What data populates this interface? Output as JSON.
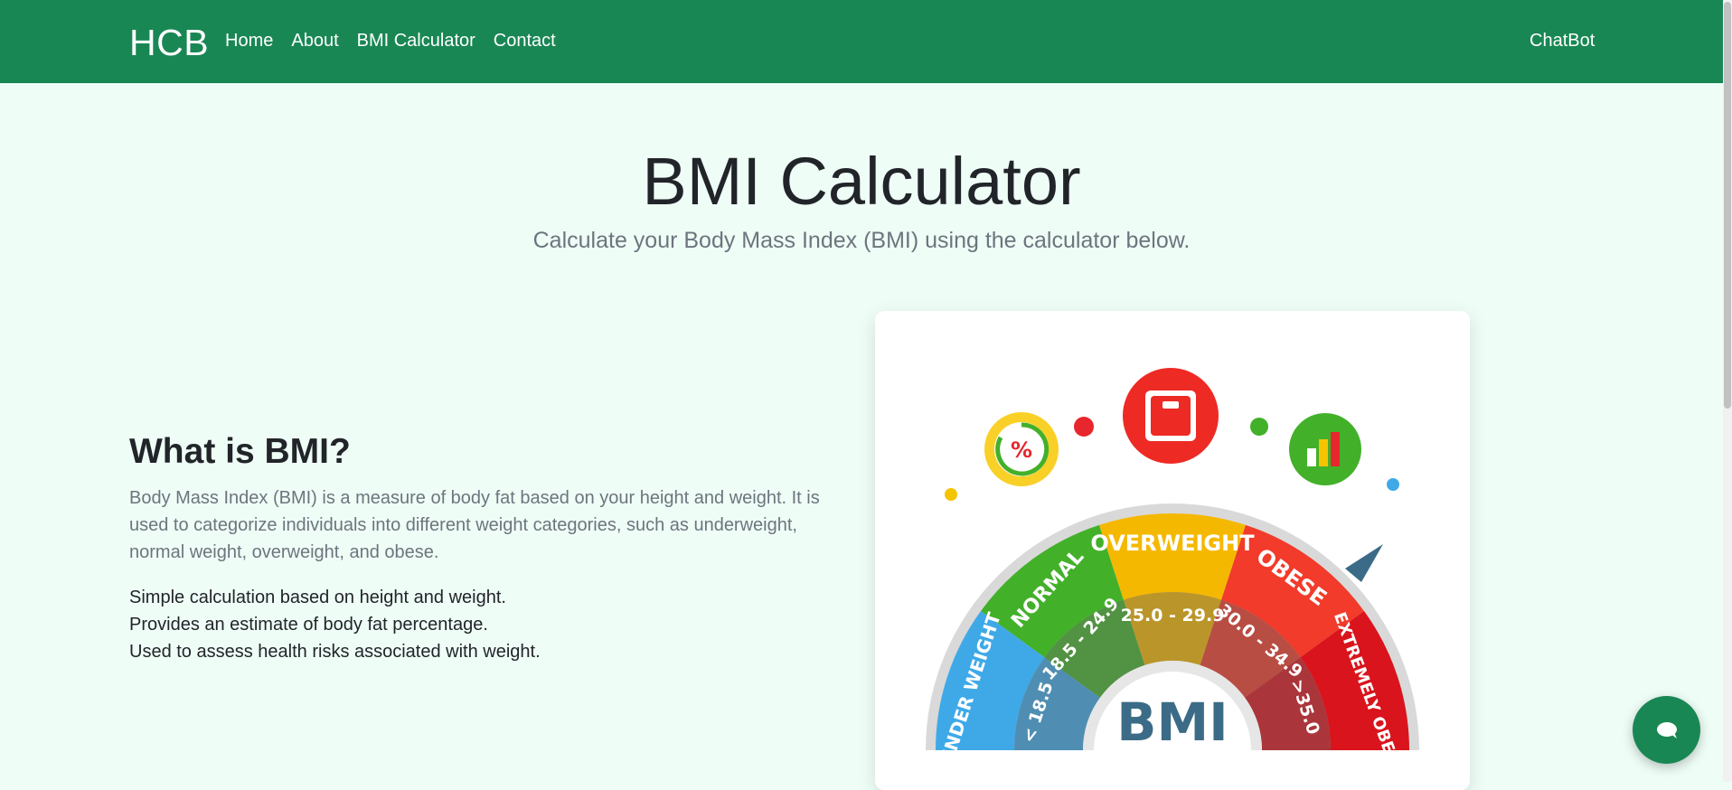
{
  "navbar": {
    "brand": "HCB",
    "links": [
      "Home",
      "About",
      "BMI Calculator",
      "Contact"
    ],
    "chatbot_label": "ChatBot",
    "bg_color": "#198754"
  },
  "hero": {
    "title": "BMI Calculator",
    "subtitle": "Calculate your Body Mass Index (BMI) using the calculator below."
  },
  "info": {
    "heading": "What is BMI?",
    "description": "Body Mass Index (BMI) is a measure of body fat based on your height and weight. It is used to categorize individuals into different weight categories, such as underweight, normal weight, overweight, and obese.",
    "features": [
      "Simple calculation based on height and weight.",
      "Provides an estimate of body fat percentage.",
      "Used to assess health risks associated with weight."
    ]
  },
  "bmi_image": {
    "center_label": "BMI",
    "percent_symbol": "%",
    "segments": [
      {
        "label": "UNDER WEIGHT",
        "range": "< 18.5",
        "color": "#3fa9e8"
      },
      {
        "label": "NORMAL",
        "range": "18.5 - 24.9",
        "color": "#43b02a"
      },
      {
        "label": "OVERWEIGHT",
        "range": "25.0 - 29.9",
        "color": "#f5b800"
      },
      {
        "label": "OBESE",
        "range": "30.0 - 34.9",
        "color": "#f23b2b"
      },
      {
        "label": "EXTREMELY OBESE",
        "range": ">35.0",
        "color": "#d9141c"
      }
    ]
  },
  "chat_fab": {
    "icon": "chat-bubble-icon",
    "color": "#198754"
  },
  "background_color": "#effdf7"
}
